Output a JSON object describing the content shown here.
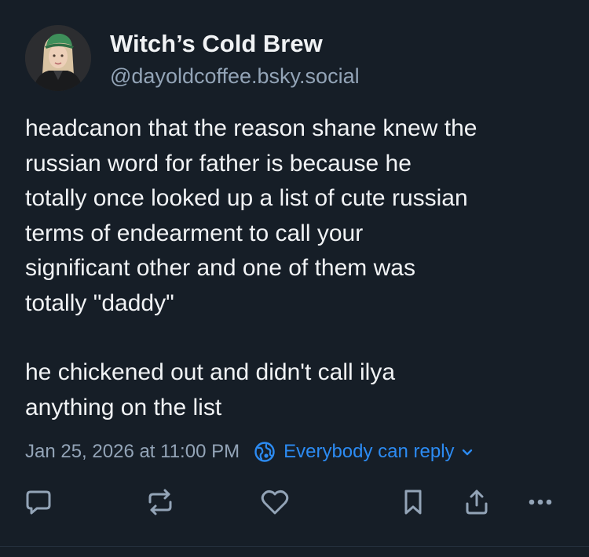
{
  "post": {
    "author": {
      "display_name": "Witch’s Cold Brew",
      "handle": "@dayoldcoffee.bsky.social"
    },
    "paragraphs": [
      "headcanon that the reason shane knew the\nrussian word for father is because he\ntotally once looked up a list of cute russian\nterms of endearment to call your\nsignificant other and one of them was\ntotally \"daddy\"",
      "he chickened out and didn't call ilya\nanything on the list"
    ],
    "timestamp": "Jan 25, 2026 at 11:00 PM",
    "reply_setting": "Everybody can reply"
  },
  "icons": {
    "reply_setting": "globe-icon",
    "chevron": "chevron-down-icon",
    "actions": [
      "reply-icon",
      "repost-icon",
      "like-icon",
      "bookmark-icon",
      "share-icon",
      "more-icon"
    ]
  },
  "colors": {
    "background": "#161e27",
    "text": "#f1f3f5",
    "muted": "#93a4b7",
    "accent": "#2c8bf2"
  }
}
